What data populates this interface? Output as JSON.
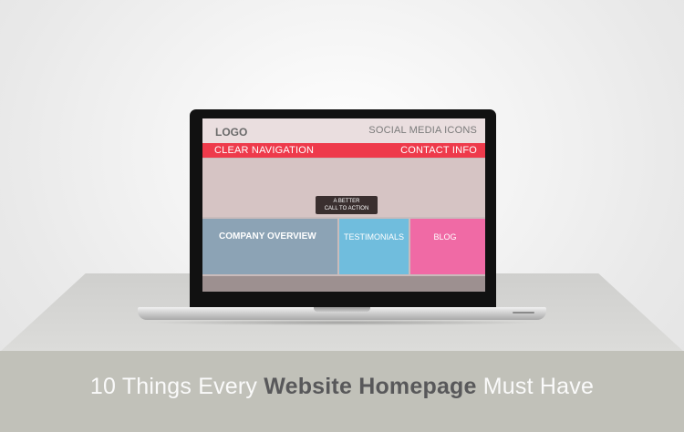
{
  "screen": {
    "logo": "LOGO",
    "social": "SOCIAL MEDIA ICONS",
    "nav_left": "CLEAR NAVIGATION",
    "nav_right": "CONTACT INFO",
    "cta_line1": "A BETTER",
    "cta_line2": "CALL TO ACTION",
    "company": "COMPANY OVERVIEW",
    "testimonials": "TESTIMONIALS",
    "blog": "BLOG"
  },
  "caption": {
    "prefix": "10 Things Every ",
    "bold": "Website Homepage",
    "suffix": " Must Have"
  },
  "colors": {
    "nav": "#ee3a4b",
    "company": "#8ca3b5",
    "testimonials": "#70bddd",
    "blog": "#f06aa5",
    "band": "#c1c1b9"
  }
}
